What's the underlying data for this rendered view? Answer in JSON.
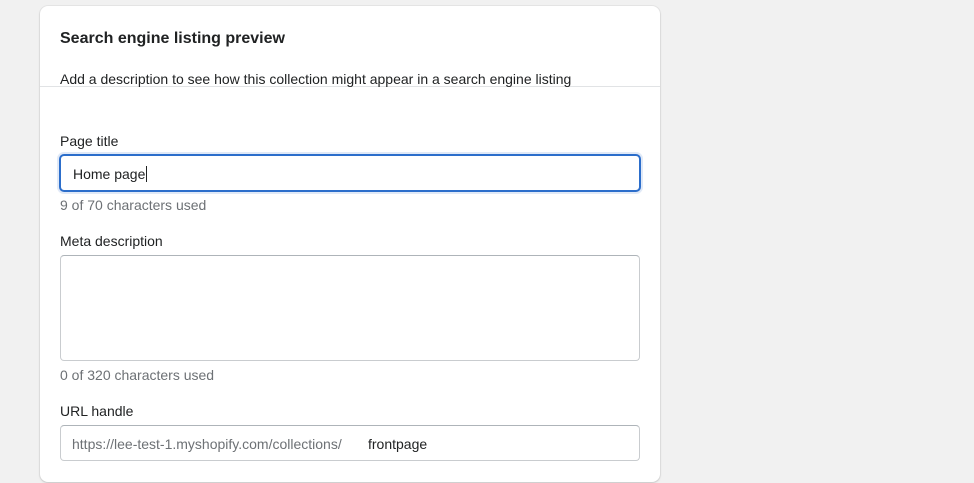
{
  "card": {
    "title": "Search engine listing preview",
    "description": "Add a description to see how this collection might appear in a search engine listing"
  },
  "page_title": {
    "label": "Page title",
    "value": "Home page",
    "help": "9 of 70 characters used"
  },
  "meta_description": {
    "label": "Meta description",
    "value": "",
    "help": "0 of 320 characters used"
  },
  "url_handle": {
    "label": "URL handle",
    "prefix": "https://lee-test-1.myshopify.com/collections/",
    "value": "frontpage"
  },
  "colors": {
    "focus_ring": "#2c6ecb",
    "help_text": "#6d7175",
    "card_bg": "#ffffff",
    "page_bg": "#f1f1f1"
  }
}
